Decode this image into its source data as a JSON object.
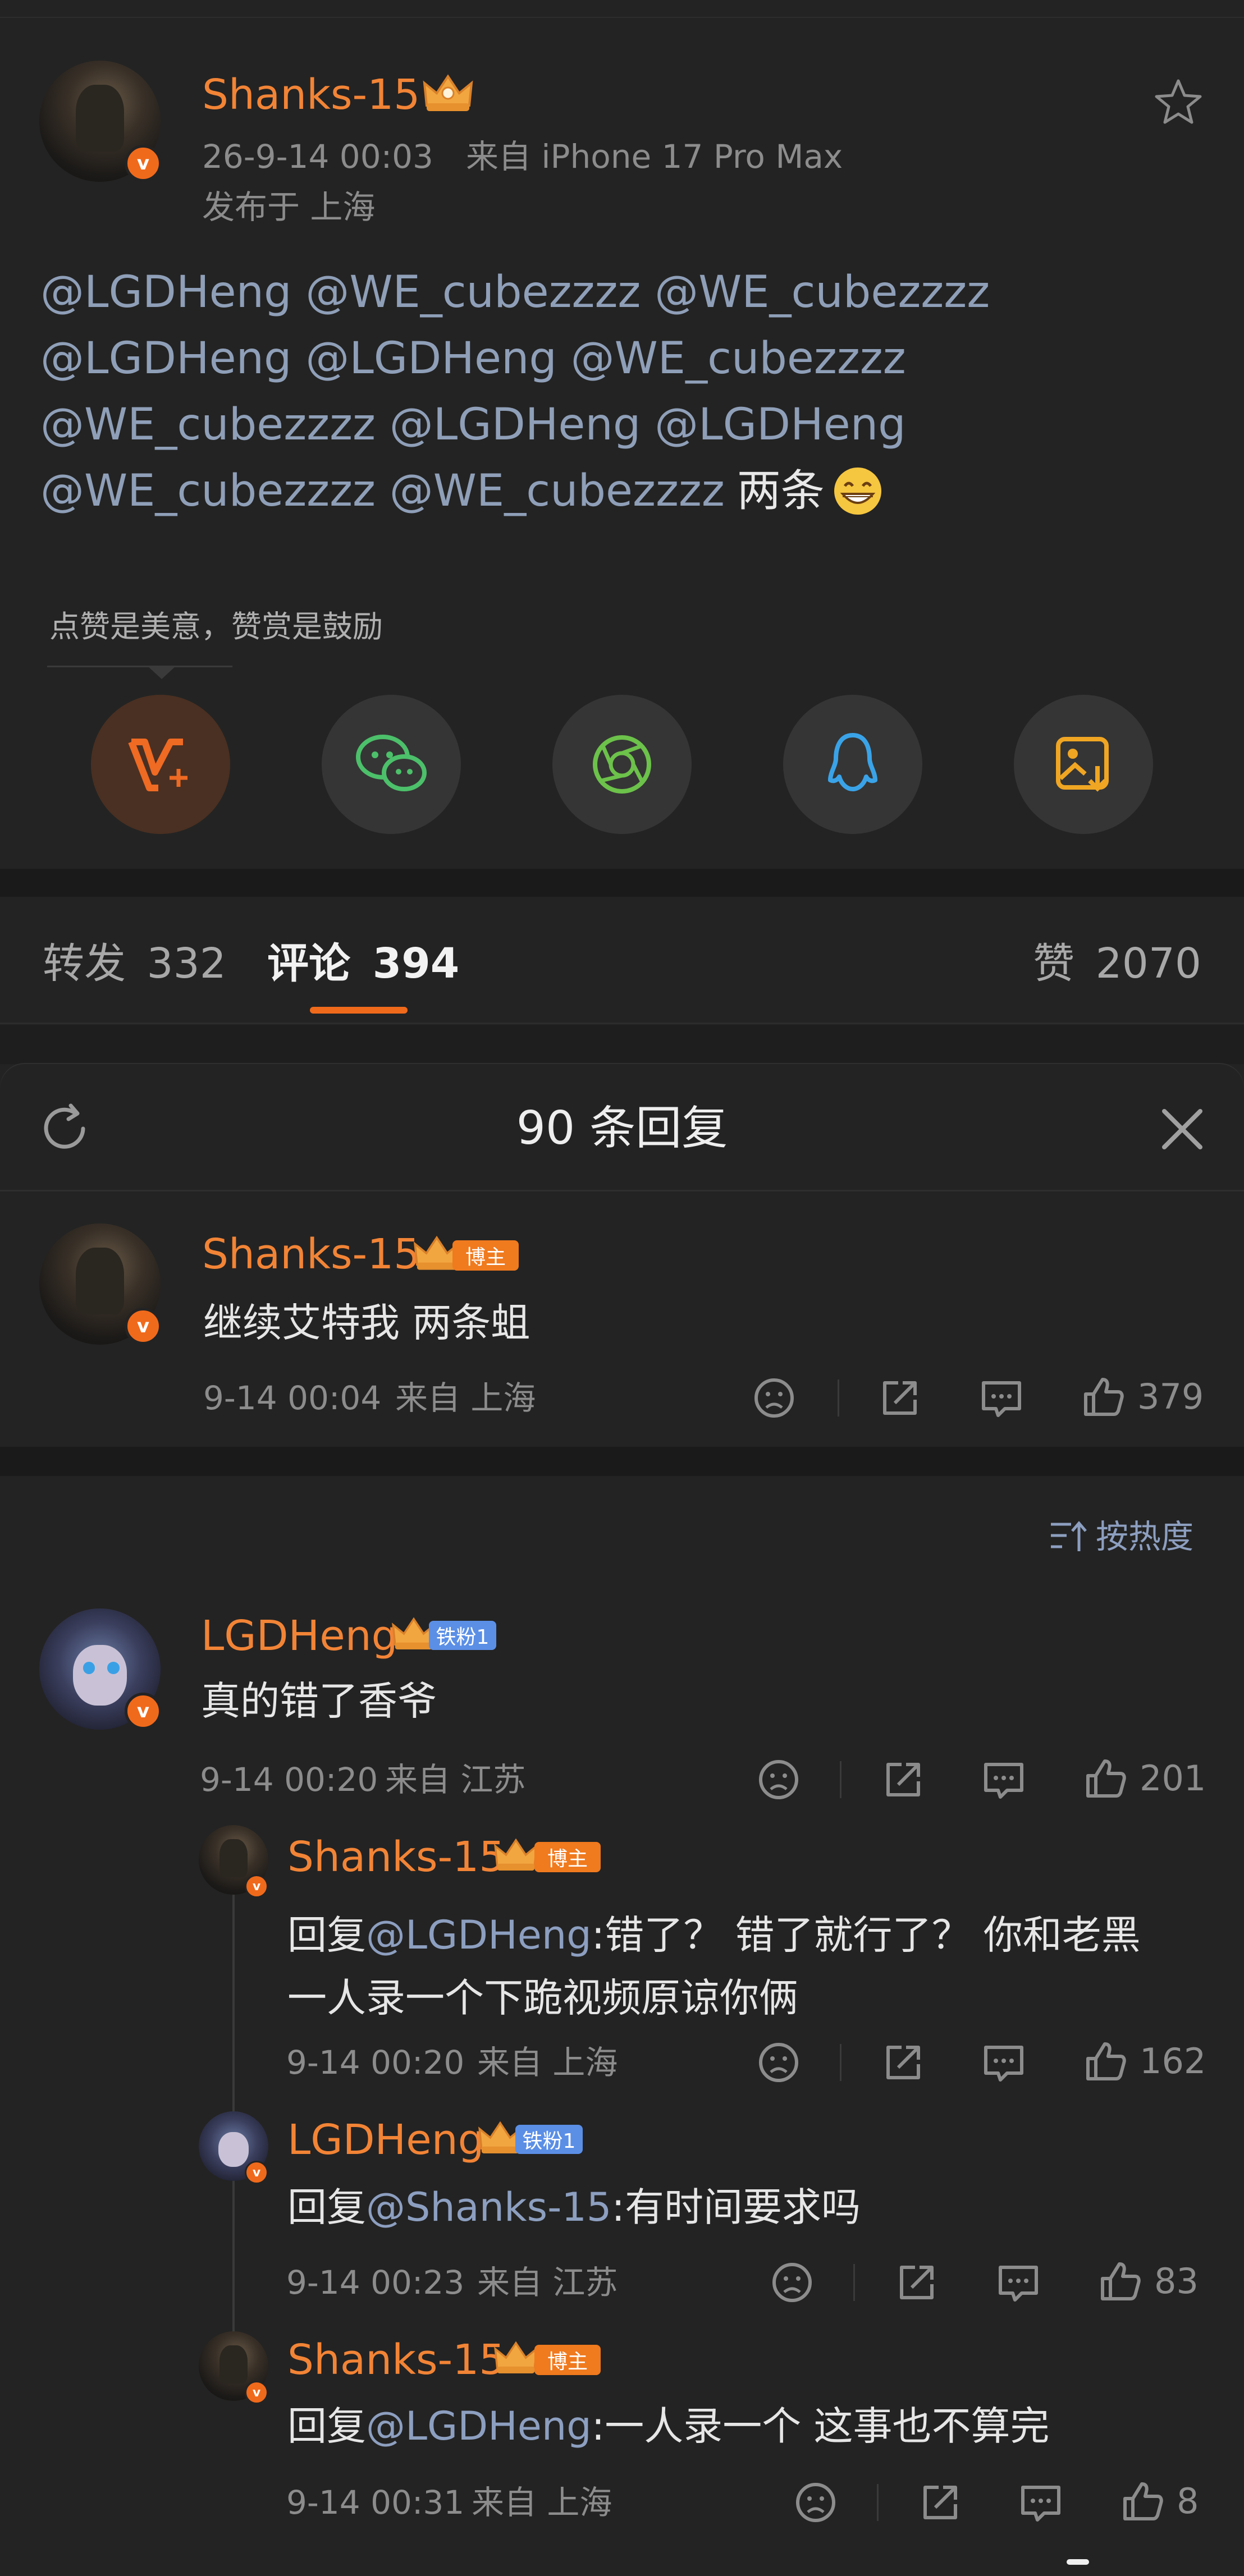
{
  "post": {
    "author": "Shanks-15",
    "timestamp": "26-9-14 00:03",
    "source": "来自 iPhone 17 Pro Max",
    "location": "发布于 上海",
    "lines": [
      "@LGDHeng @WE_cubezzzz @WE_cubezzzz",
      "@LGDHeng @LGDHeng @WE_cubezzzz",
      "@WE_cubezzzz @LGDHeng @LGDHeng",
      "@WE_cubezzzz @WE_cubezzzz"
    ],
    "line4_suffix": "两条",
    "reward_hint": "点赞是美意，赞赏是鼓励",
    "share_icons": [
      "v-plus-reward-icon",
      "wechat-icon",
      "moments-icon",
      "qq-icon",
      "save-image-icon"
    ]
  },
  "tabs": {
    "repost_label": "转发",
    "repost_count": "332",
    "comment_label": "评论",
    "comment_count": "394",
    "like_label": "赞",
    "like_count": "2070"
  },
  "sheet": {
    "title": "90 条回复",
    "sort_label": "按热度"
  },
  "root_comment": {
    "author": "Shanks-15",
    "badge": "博主",
    "text": "继续艾特我 两条蛆",
    "time": "9-14 00:04",
    "location": "来自 上海",
    "likes": "379"
  },
  "comments": [
    {
      "author": "LGDHeng",
      "badge": "铁粉1",
      "text": "真的错了香爷",
      "time": "9-14 00:20",
      "location": "来自 江苏",
      "likes": "201"
    }
  ],
  "replies": [
    {
      "author": "Shanks-15",
      "badge": "博主",
      "prefix": "回复",
      "mention": "@LGDHeng",
      "text_line1": ":错了？ 错了就行了？ 你和老黑",
      "text_line2": "一人录一个下跪视频原谅你俩",
      "time": "9-14 00:20",
      "location": "来自 上海",
      "likes": "162"
    },
    {
      "author": "LGDHeng",
      "badge": "铁粉1",
      "prefix": "回复",
      "mention": "@Shanks-15",
      "text_line1": ":有时间要求吗",
      "time": "9-14 00:23",
      "location": "来自 江苏",
      "likes": "83"
    },
    {
      "author": "Shanks-15",
      "badge": "博主",
      "prefix": "回复",
      "mention": "@LGDHeng",
      "text_line1": ":一人录一个 这事也不算完",
      "time": "9-14 00:31",
      "location": "来自 上海",
      "likes": "8"
    }
  ],
  "colors": {
    "username": "#f28436",
    "mention": "#8d9fc0",
    "verified": "#f06a1b",
    "blogger_tag": "#f07a1e",
    "fan_tag": "#5b8fe6",
    "tab_indicator": "#f06a1b"
  }
}
